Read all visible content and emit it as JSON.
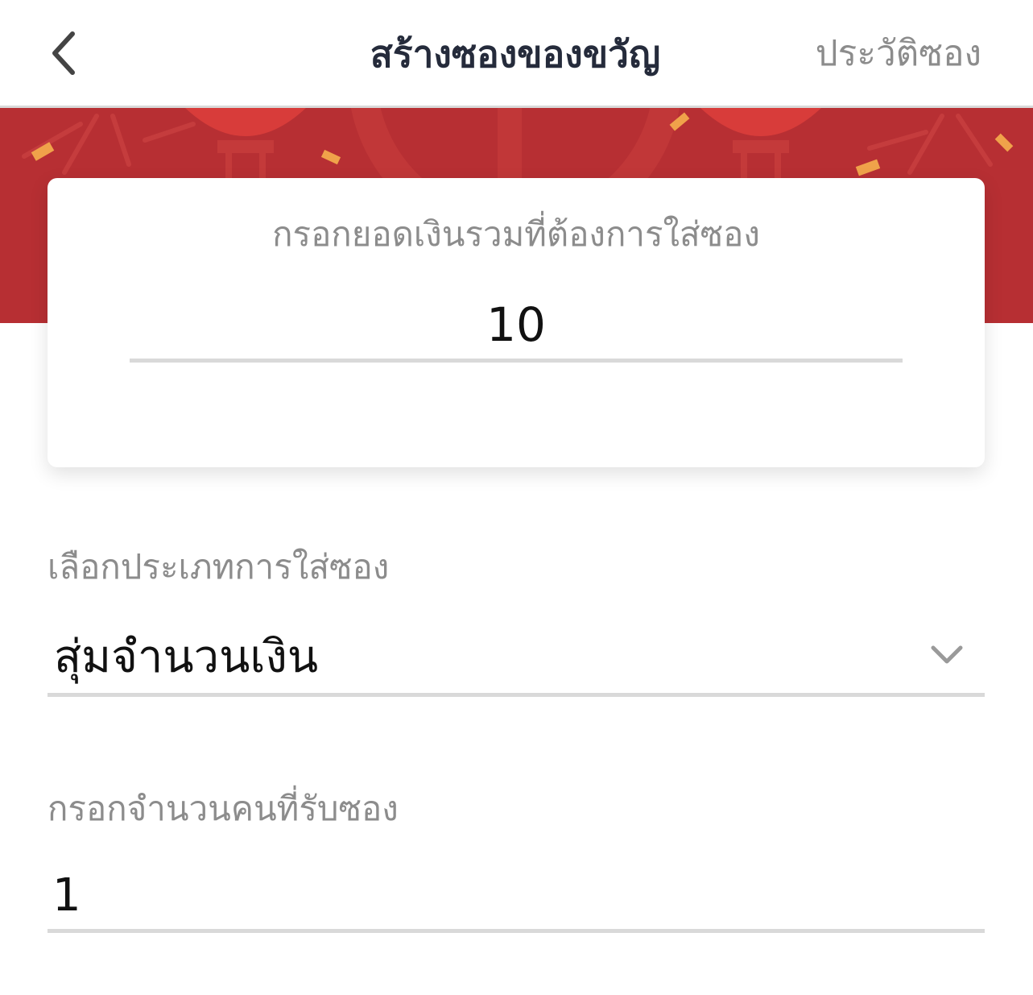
{
  "header": {
    "title": "สร้างซองของขวัญ",
    "history_link": "ประวัติซอง"
  },
  "amount_card": {
    "label": "กรอกยอดเงินรวมที่ต้องการใส่ซอง",
    "value": "10"
  },
  "type_select": {
    "label": "เลือกประเภทการใส่ซอง",
    "selected": "สุ่มจำนวนเงิน"
  },
  "recipients": {
    "label": "กรอกจำนวนคนที่รับซอง",
    "value": "1"
  },
  "colors": {
    "banner_red": "#b72f33",
    "title_text": "#252b3b",
    "muted_text": "#8c8c8c",
    "divider": "#d9d9d9"
  }
}
